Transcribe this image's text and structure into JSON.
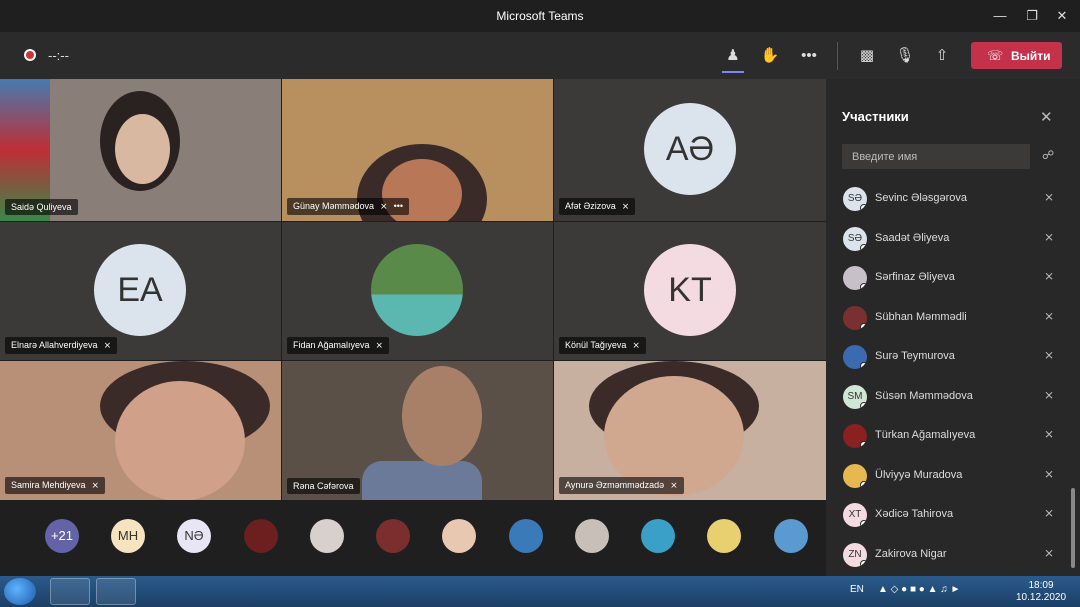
{
  "window": {
    "title": "Microsoft Teams",
    "minimize_icon": "minimize-icon",
    "maximize_icon": "maximize-icon",
    "close_icon": "close-icon"
  },
  "toolbar": {
    "timer": "--:--",
    "leave_label": "Выйти",
    "icons": [
      "participants-icon",
      "raise-hand-icon",
      "more-icon",
      "camera-off-icon",
      "mic-off-icon",
      "share-icon"
    ],
    "leave_color": "#c4314b"
  },
  "tiles": [
    {
      "name": "Saidə Quliyeva",
      "type": "video",
      "muted": false
    },
    {
      "name": "Günay Məmmədova",
      "type": "video",
      "muted": true,
      "more": "•••"
    },
    {
      "name": "Afət Əzizova",
      "type": "avatar",
      "initials": "AƏ",
      "muted": true,
      "color": "#dbe4ec"
    },
    {
      "name": "Elnarə Allahverdiyeva",
      "type": "avatar",
      "initials": "EA",
      "muted": true,
      "color": "#dbe4ec"
    },
    {
      "name": "Fidan Ağamalıyeva",
      "type": "photo",
      "muted": true
    },
    {
      "name": "Könül Tağıyeva",
      "type": "avatar",
      "initials": "KT",
      "muted": true,
      "color": "#f4dbe1"
    },
    {
      "name": "Samira Mehdiyeva",
      "type": "video",
      "muted": true
    },
    {
      "name": "Rəna Cəfərova",
      "type": "video",
      "muted": false
    },
    {
      "name": "Aynurə Əzməmmədzadə",
      "type": "video",
      "muted": true
    }
  ],
  "strip": [
    {
      "label": "+21",
      "color": "#6264a7",
      "text_color": "#ffffff"
    },
    {
      "label": "MH",
      "color": "#f6e3c0",
      "text_color": "#333333"
    },
    {
      "label": "NƏ",
      "color": "#e8e6f5",
      "text_color": "#333333"
    },
    {
      "label": "",
      "color": "#6b1f1f"
    },
    {
      "label": "",
      "color": "#d8d0cc"
    },
    {
      "label": "",
      "color": "#7a2e2e"
    },
    {
      "label": "",
      "color": "#e8c8b0"
    },
    {
      "label": "",
      "color": "#3a7ab8"
    },
    {
      "label": "",
      "color": "#c8c0b8"
    },
    {
      "label": "",
      "color": "#3aa0c8"
    },
    {
      "label": "",
      "color": "#e8d070"
    },
    {
      "label": "",
      "color": "#5a9ad0"
    }
  ],
  "panel": {
    "title": "Участники",
    "search_placeholder": "Введите имя",
    "participants": [
      {
        "initials": "SƏ",
        "name": "Sevinc Ələsgərova",
        "color": "#dbe4ec"
      },
      {
        "initials": "SƏ",
        "name": "Saadət Əliyeva",
        "color": "#dbe4ec"
      },
      {
        "initials": "",
        "name": "Sərfinaz Əliyeva",
        "color": "#c8c0c8"
      },
      {
        "initials": "",
        "name": "Sübhan Məmmədli",
        "color": "#7a3030"
      },
      {
        "initials": "",
        "name": "Surə Teymurova",
        "color": "#3a6ab0"
      },
      {
        "initials": "SM",
        "name": "Süsən Məmmədova",
        "color": "#cfe8d6"
      },
      {
        "initials": "",
        "name": "Türkan Ağamalıyeva",
        "color": "#8a2020"
      },
      {
        "initials": "",
        "name": "Ülviyyə Muradova",
        "color": "#e8b850"
      },
      {
        "initials": "XT",
        "name": "Xədicə Tahirova",
        "color": "#f4dbe1"
      },
      {
        "initials": "ZN",
        "name": "Zakirova Nigar",
        "color": "#f4dbe1"
      }
    ]
  },
  "taskbar": {
    "lang": "EN",
    "time": "18:09",
    "date": "10.12.2020"
  }
}
